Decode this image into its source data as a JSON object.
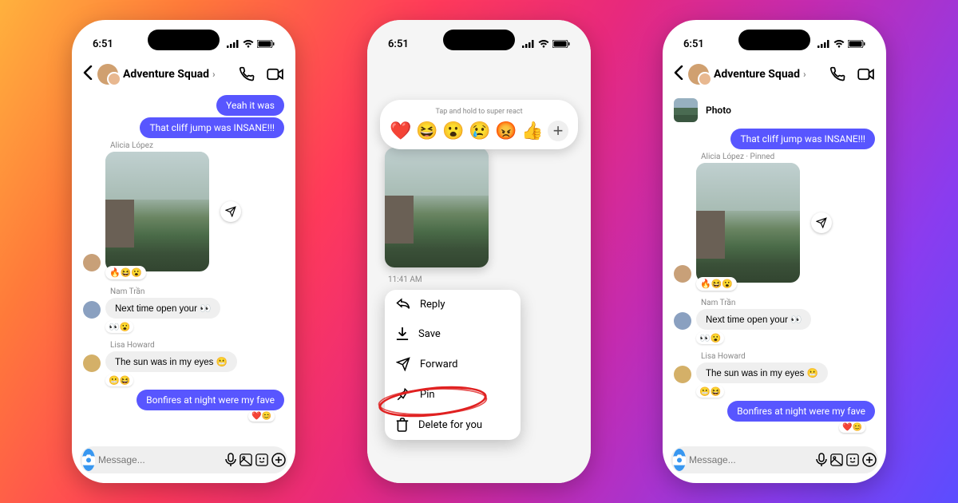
{
  "status": {
    "time": "6:51"
  },
  "header": {
    "title": "Adventure Squad"
  },
  "messages": {
    "m1": "Yeah it was",
    "m2": "That cliff jump was INSANE!!!",
    "s_alicia": "Alicia López",
    "s_alicia_pinned": "Alicia López · Pinned",
    "s_nam": "Nam Trần",
    "m_nam": "Next time open your 👀",
    "s_lisa": "Lisa Howard",
    "m_lisa": "The sun was in my eyes 😬",
    "m_bonfire": "Bonfires at night were my fave"
  },
  "pinned": {
    "label": "Photo"
  },
  "composer": {
    "placeholder": "Message..."
  },
  "react_bar": {
    "hint": "Tap and hold to super react",
    "e1": "❤️",
    "e2": "😆",
    "e3": "😮",
    "e4": "😢",
    "e5": "😡",
    "e6": "👍"
  },
  "ctx": {
    "time": "11:41 AM",
    "reply": "Reply",
    "save": "Save",
    "forward": "Forward",
    "pin": "Pin",
    "delete": "Delete for you"
  },
  "reacts": {
    "photo": "🔥😆😮",
    "nam": "👀😮",
    "lisa": "😬😆",
    "bonfire": "❤️😊"
  }
}
